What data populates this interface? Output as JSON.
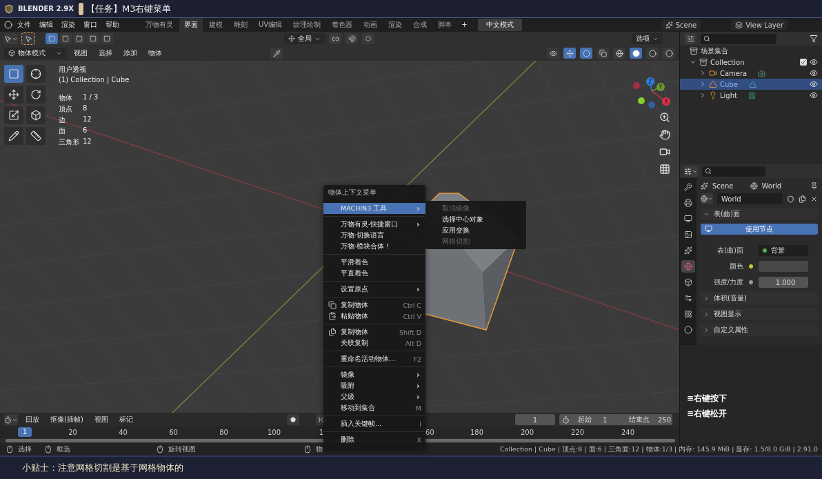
{
  "banner": {
    "logo": "BLENDER 2.9X",
    "title": "【任务】M3右键菜单"
  },
  "menubar": {
    "menus": [
      "文件",
      "编辑",
      "渲染",
      "窗口",
      "帮助"
    ],
    "workspaces": [
      {
        "label": "万物有灵",
        "selected": false
      },
      {
        "label": "界面",
        "selected": true
      },
      {
        "label": "建模",
        "selected": false
      },
      {
        "label": "雕刻",
        "selected": false
      },
      {
        "label": "UV编辑",
        "selected": false
      },
      {
        "label": "纹理绘制",
        "selected": false
      },
      {
        "label": "着色器",
        "selected": false
      },
      {
        "label": "动画",
        "selected": false
      },
      {
        "label": "渲染",
        "selected": false
      },
      {
        "label": "合成",
        "selected": false
      },
      {
        "label": "脚本",
        "selected": false
      }
    ],
    "add_tab": "+",
    "mode_button": "中文模式",
    "scene": "Scene",
    "view_layer": "View Layer"
  },
  "tool_header": {
    "select_modes": [
      {
        "selected": true
      },
      {
        "selected": false
      },
      {
        "selected": false
      },
      {
        "selected": false
      },
      {
        "selected": false
      }
    ],
    "orientation": "全局",
    "options": "选项"
  },
  "viewport_header": {
    "mode": "物体模式",
    "menus": [
      "视图",
      "选择",
      "添加",
      "物体"
    ]
  },
  "viewport": {
    "view_name": "用户透视",
    "collection": "(1) Collection | Cube",
    "stats": [
      {
        "label": "物体",
        "value": "1 / 3"
      },
      {
        "label": "顶点",
        "value": "8"
      },
      {
        "label": "边",
        "value": "12"
      },
      {
        "label": "面",
        "value": "6"
      },
      {
        "label": "三角形",
        "value": "12"
      }
    ],
    "tools": [
      {
        "selected": true
      },
      {
        "selected": false
      },
      {
        "selected": false
      },
      {
        "selected": false
      },
      {
        "selected": false
      },
      {
        "selected": false
      },
      {
        "selected": false
      },
      {
        "selected": false
      }
    ],
    "axes": [
      {
        "label": "Z",
        "color": "#2f7fe0"
      },
      {
        "label": "Y",
        "color": "#6c9b2c"
      },
      {
        "label": "X",
        "color": "#e0304a"
      }
    ]
  },
  "context_menu": {
    "title": "物体上下文菜单",
    "groups": [
      [
        {
          "label": "MACHIN3 工具",
          "submenu": true,
          "selected": true,
          "kind": "plain"
        }
      ],
      [
        {
          "label": "万物有灵-快捷窗口",
          "submenu": true,
          "selected": false,
          "kind": "plain"
        },
        {
          "label": "万物·切换语言",
          "submenu": false,
          "selected": false,
          "kind": "plain"
        },
        {
          "label": "万物·模块合体！",
          "submenu": false,
          "selected": false,
          "kind": "plain"
        }
      ],
      [
        {
          "label": "平滑着色",
          "submenu": false,
          "selected": false,
          "kind": "plain"
        },
        {
          "label": "平直着色",
          "submenu": false,
          "selected": false,
          "kind": "plain"
        }
      ],
      [
        {
          "label": "设置原点",
          "submenu": true,
          "selected": false,
          "kind": "plain"
        }
      ],
      [
        {
          "label": "复制物体",
          "shortcut": "Ctrl C",
          "submenu": false,
          "selected": false,
          "kind": "icon"
        },
        {
          "label": "粘贴物体",
          "shortcut": "Ctrl V",
          "submenu": false,
          "selected": false,
          "kind": "icon"
        }
      ],
      [
        {
          "label": "复制物体",
          "shortcut": "Shift D",
          "submenu": false,
          "selected": false,
          "kind": "icon"
        },
        {
          "label": "关联复制",
          "shortcut": "Alt D",
          "submenu": false,
          "selected": false,
          "kind": "plain"
        }
      ],
      [
        {
          "label": "重命名活动物体...",
          "shortcut": "F2",
          "submenu": false,
          "selected": false,
          "kind": "plain"
        }
      ],
      [
        {
          "label": "镜像",
          "submenu": true,
          "selected": false,
          "kind": "plain"
        },
        {
          "label": "吸附",
          "submenu": true,
          "selected": false,
          "kind": "plain"
        },
        {
          "label": "父级",
          "submenu": true,
          "selected": false,
          "kind": "plain"
        },
        {
          "label": "移动到集合",
          "shortcut": "M",
          "submenu": false,
          "selected": false,
          "kind": "plain"
        }
      ],
      [
        {
          "label": "插入关键帧...",
          "shortcut": "I",
          "submenu": false,
          "selected": false,
          "kind": "plain"
        }
      ],
      [
        {
          "label": "删除",
          "shortcut": "X",
          "submenu": false,
          "selected": false,
          "kind": "plain"
        }
      ]
    ]
  },
  "submenu": {
    "items": [
      {
        "label": "取消镜像",
        "disabled": true
      },
      {
        "label": "选择中心对象",
        "disabled": false
      },
      {
        "label": "应用变换",
        "disabled": false
      },
      {
        "label": "网格切割",
        "disabled": true
      }
    ]
  },
  "outliner": {
    "root": "场景集合",
    "children": [
      {
        "label": "Collection",
        "kind": "collection",
        "checked": true,
        "expanded": true,
        "selected": false,
        "children": [
          {
            "label": "Camera",
            "kind": "camera",
            "expanded": false,
            "selected": false
          },
          {
            "label": "Cube",
            "kind": "mesh",
            "expanded": false,
            "selected": true
          },
          {
            "label": "Light",
            "kind": "light",
            "expanded": false,
            "selected": false
          }
        ]
      }
    ]
  },
  "properties": {
    "tabs": [
      {
        "selected": false
      },
      {
        "selected": false
      },
      {
        "selected": false
      },
      {
        "selected": false
      },
      {
        "selected": false
      },
      {
        "selected": true
      },
      {
        "selected": false
      },
      {
        "selected": false
      },
      {
        "selected": false
      },
      {
        "selected": false
      }
    ],
    "breadcrumb": [
      "Scene",
      "World"
    ],
    "world": "World",
    "panels": [
      {
        "label": "表(曲)面",
        "expanded": true
      },
      {
        "label": "体积(音量)",
        "expanded": false
      },
      {
        "label": "视图显示",
        "expanded": false
      },
      {
        "label": "自定义属性",
        "expanded": false
      }
    ],
    "use_nodes": {
      "label": "使用节点",
      "on": true
    },
    "fields": [
      {
        "label": "表(曲)面",
        "kind": "link",
        "value": "背景",
        "color": "#4fb04f"
      },
      {
        "label": "颜色",
        "kind": "color",
        "color": "#c8c832"
      },
      {
        "label": "强度/力度",
        "kind": "number",
        "value": "1.000",
        "color": "#9a9a9a"
      }
    ]
  },
  "key_display": [
    "≡右键按下",
    "≡右键松开"
  ],
  "timeline": {
    "menus": [
      "回放",
      "抠像(插帧)",
      "视图",
      "标记"
    ],
    "current_frame": "1",
    "start_label": "起始",
    "start": "1",
    "end_label": "结束点",
    "end": "250",
    "ruler_marker": "1",
    "ticks_before_menu": [
      "20",
      "40",
      "60",
      "80",
      "100",
      "1"
    ],
    "ticks_after_menu": [
      "60",
      "180",
      "200",
      "220",
      "240"
    ]
  },
  "status_bar": {
    "hints": [
      "选择",
      "框选",
      "旋转视图",
      "物"
    ],
    "info": "Collection | Cube | 顶点:8 | 面:6 | 三角面:12 | 物体:1/3 | 内存: 145.9 MiB | 显存: 1.5/8.0 GiB | 2.91.0"
  },
  "tip": "小贴士：注意网格切割是基于网格物体的"
}
